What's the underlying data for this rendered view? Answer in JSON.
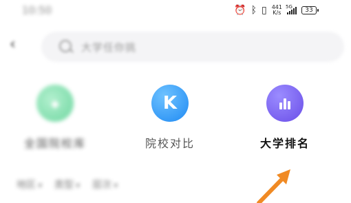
{
  "status_bar": {
    "time": "10:50",
    "net_speed_value": "441",
    "net_speed_unit": "K/s",
    "network_type": "5G",
    "battery": "33"
  },
  "search": {
    "placeholder": "大学任你挑"
  },
  "features": [
    {
      "label": "全国院校库",
      "icon": "school-icon",
      "color": "#54cf8f"
    },
    {
      "label": "院校对比",
      "icon": "k-logo-icon",
      "color": "#1f8af3"
    },
    {
      "label": "大学排名",
      "icon": "bar-chart-icon",
      "color": "#6a4ee8"
    }
  ],
  "filters": [
    "地区",
    "类型",
    "层次"
  ],
  "colors": {
    "annotation_arrow": "#f08a24",
    "accent_blue": "#1f8af3",
    "accent_purple": "#6a4ee8"
  }
}
